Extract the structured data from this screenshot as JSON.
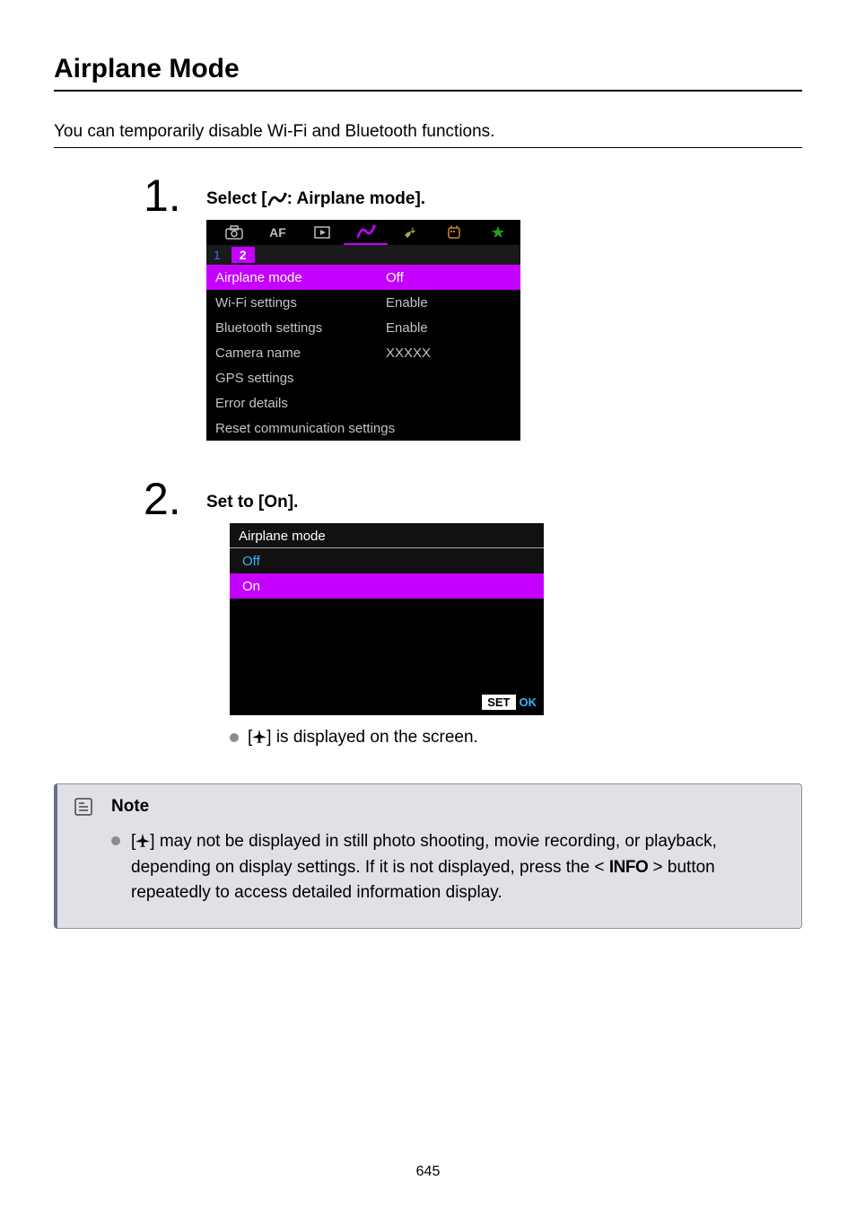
{
  "title": "Airplane Mode",
  "intro": "You can temporarily disable Wi-Fi and Bluetooth functions.",
  "steps": [
    {
      "num": "1.",
      "title_prefix": "Select [",
      "title_suffix": ": Airplane mode].",
      "menu": {
        "tabs": [
          "camera",
          "AF",
          "play",
          "wireless",
          "wrench",
          "custom",
          "star"
        ],
        "pages": [
          "1",
          "2"
        ],
        "items": [
          {
            "label": "Airplane mode",
            "value": "Off",
            "hl": true
          },
          {
            "label": "Wi-Fi settings",
            "value": "Enable"
          },
          {
            "label": "Bluetooth settings",
            "value": "Enable"
          },
          {
            "label": "Camera name",
            "value": "XXXXX"
          },
          {
            "label": "GPS settings",
            "value": ""
          },
          {
            "label": "Error details",
            "value": ""
          },
          {
            "label": "Reset communication settings",
            "value": ""
          }
        ]
      }
    },
    {
      "num": "2.",
      "title": "Set to [On].",
      "dialog": {
        "header": "Airplane mode",
        "off": "Off",
        "on": "On",
        "set": "SET",
        "ok": "OK"
      },
      "after_text": "] is displayed on the screen."
    }
  ],
  "note": {
    "heading": "Note",
    "text_prefix": "[",
    "text_mid": "] may not be displayed in still photo shooting, movie recording, or playback, depending on display settings. If it is not displayed, press the < ",
    "info_label": "INFO",
    "text_suffix": " > button repeatedly to access detailed information display."
  },
  "page_number": "645"
}
